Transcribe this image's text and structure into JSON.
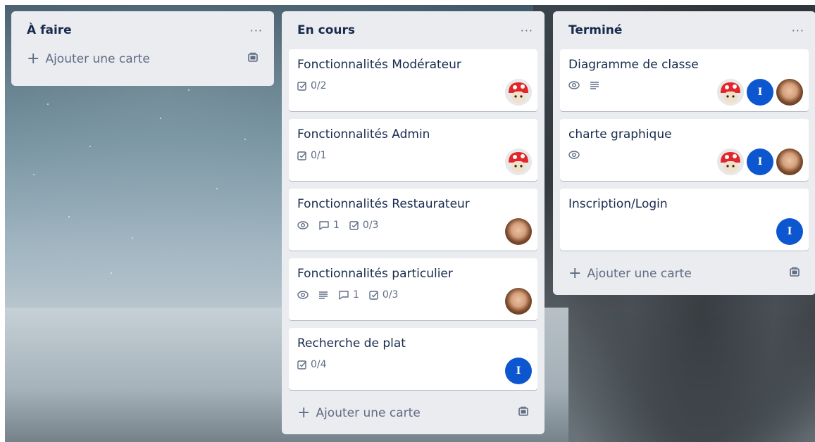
{
  "lists": [
    {
      "title": "À faire",
      "menu": "···",
      "add_label": "Ajouter une carte",
      "cards": []
    },
    {
      "title": "En cours",
      "menu": "···",
      "add_label": "Ajouter une carte",
      "cards": [
        {
          "title": "Fonctionnalités Modérateur",
          "checklist": "0/2"
        },
        {
          "title": "Fonctionnalités Admin",
          "checklist": "0/1"
        },
        {
          "title": "Fonctionnalités Restaurateur",
          "comments": "1",
          "checklist": "0/3"
        },
        {
          "title": "Fonctionnalités particulier",
          "comments": "1",
          "checklist": "0/3"
        },
        {
          "title": "Recherche de plat",
          "checklist": "0/4",
          "avatar_initial": "I"
        }
      ]
    },
    {
      "title": "Terminé",
      "menu": "···",
      "add_label": "Ajouter une carte",
      "cards": [
        {
          "title": "Diagramme de classe",
          "avatar_initial": "I"
        },
        {
          "title": "charte graphique",
          "avatar_initial": "I"
        },
        {
          "title": "Inscription/Login",
          "avatar_initial": "I"
        }
      ]
    }
  ],
  "colors": {
    "list_bg": "#ebecf0",
    "avatar_blue": "#0c56d0",
    "text": "#172b4d",
    "muted": "#5e6c84"
  }
}
